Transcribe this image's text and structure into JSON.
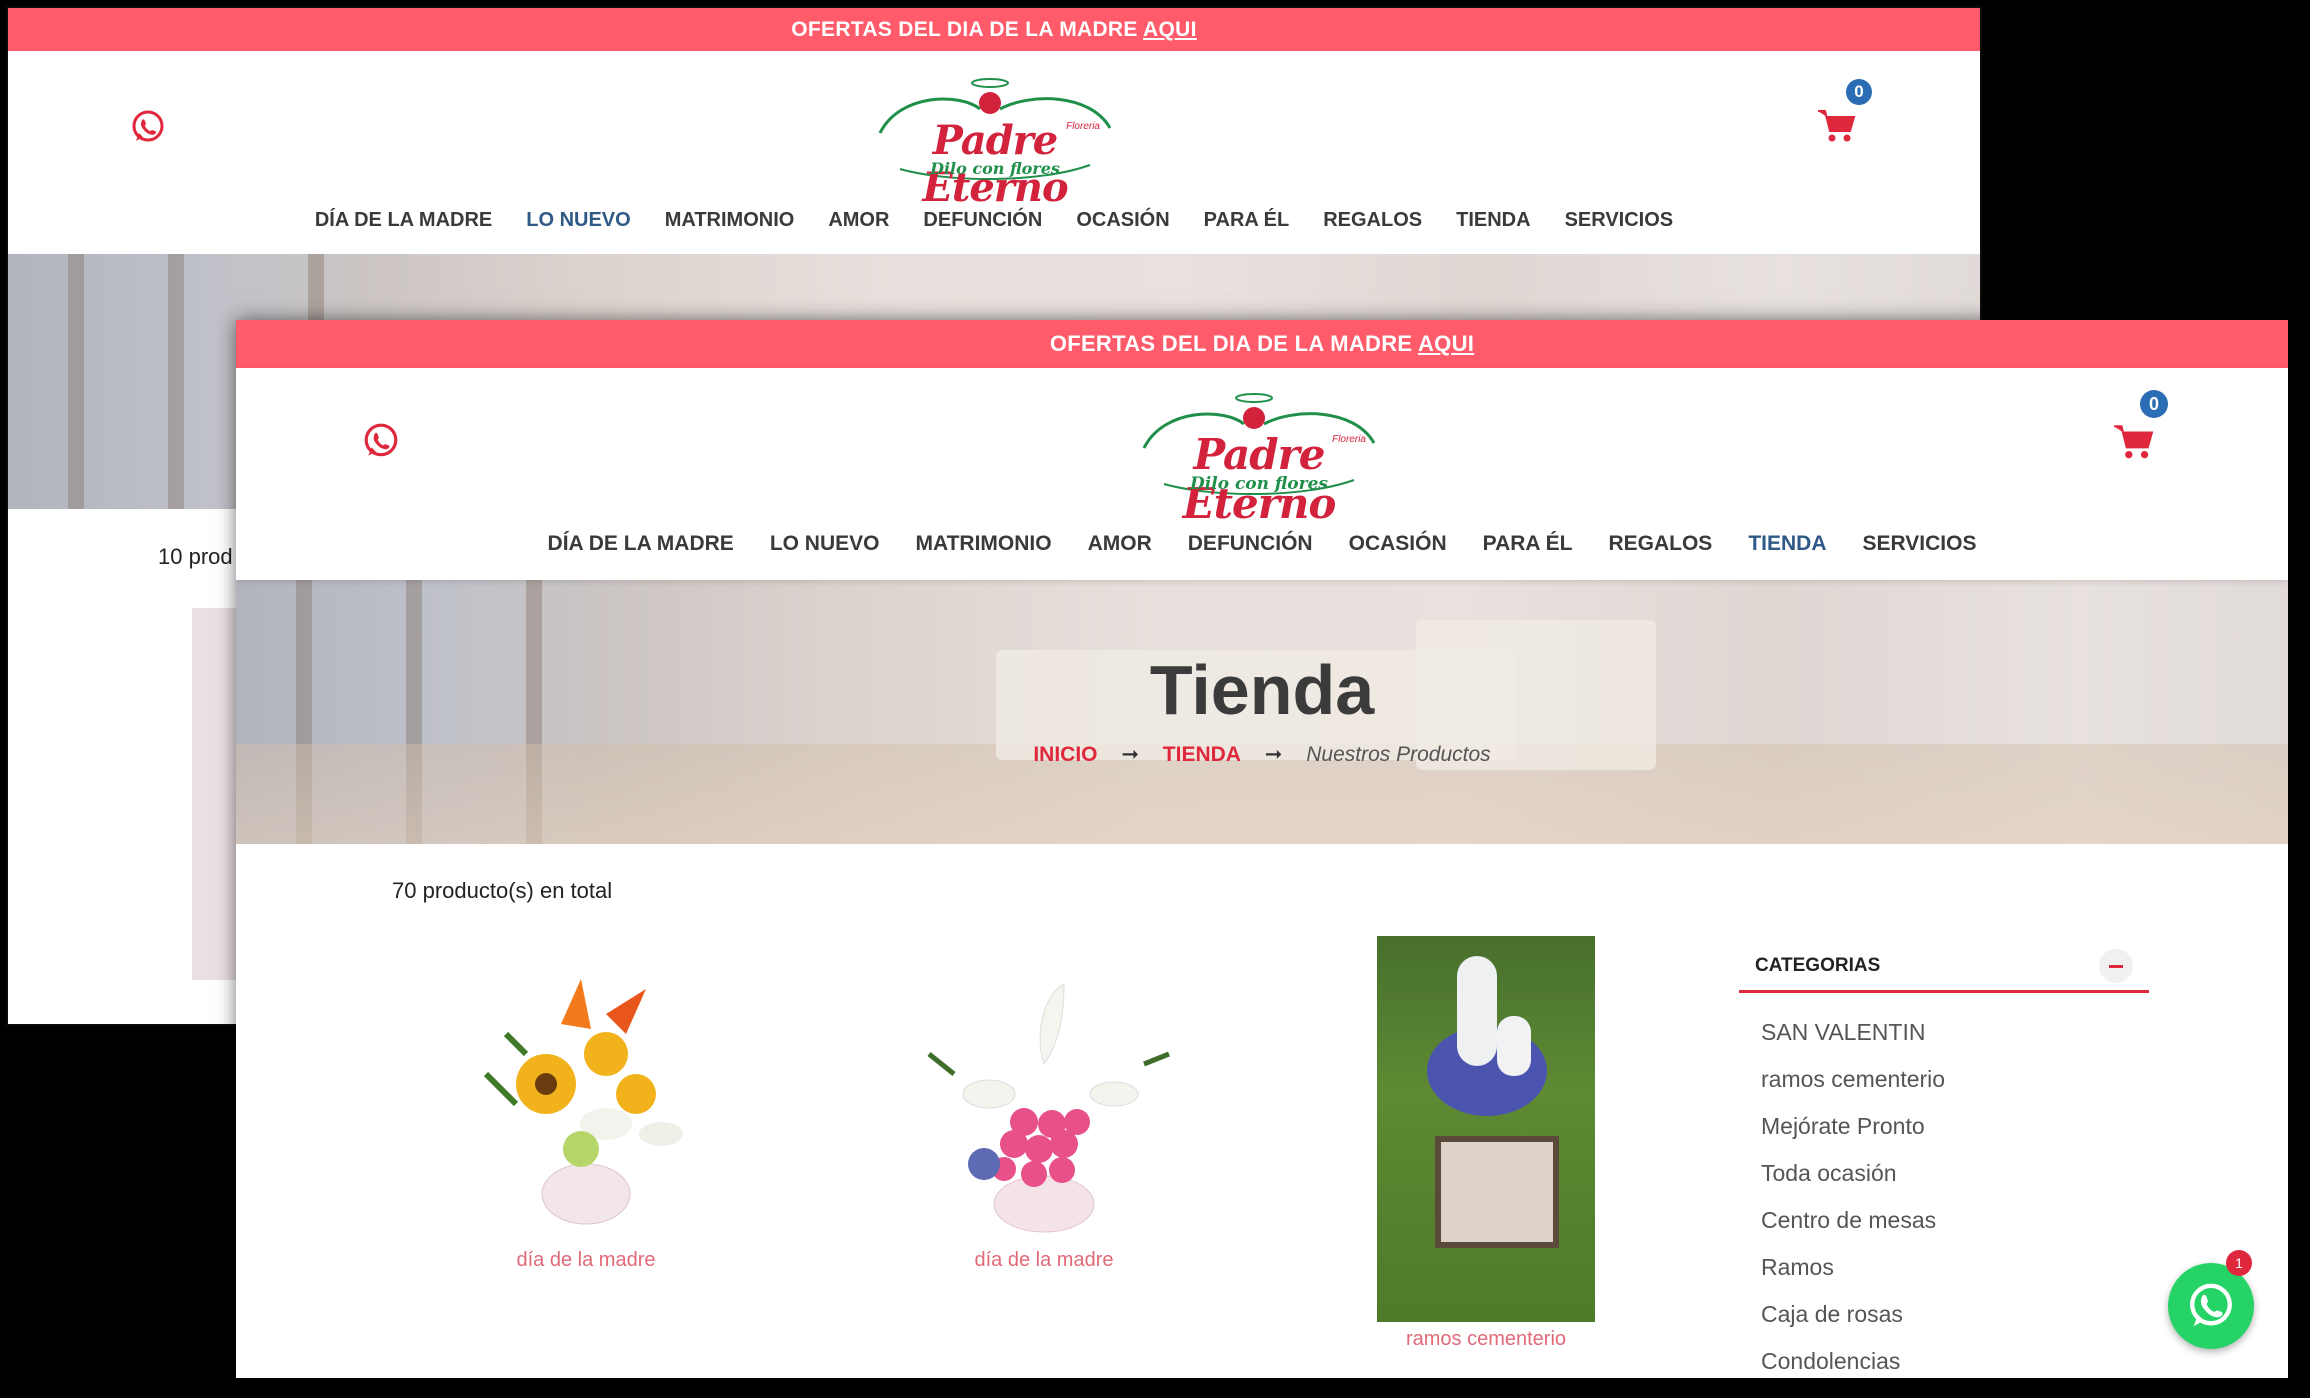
{
  "promo": {
    "text": "OFERTAS DEL DIA DE LA MADRE ",
    "link": "AQUI"
  },
  "brand": {
    "name": "Padre Eterno",
    "small": "Floreria",
    "tagline": "Dilo con flores"
  },
  "cart": {
    "count": "0"
  },
  "nav": [
    "DÍA DE LA MADRE",
    "LO NUEVO",
    "MATRIMONIO",
    "AMOR",
    "DEFUNCIÓN",
    "OCASIÓN",
    "PARA ÉL",
    "REGALOS",
    "TIENDA",
    "SERVICIOS"
  ],
  "back_window": {
    "active_nav": "LO NUEVO",
    "count_text": "10 prod"
  },
  "front_window": {
    "active_nav": "TIENDA",
    "hero_title": "Tienda",
    "breadcrumb": {
      "home": "INICIO",
      "section": "TIENDA",
      "current": "Nuestros Productos",
      "sep": "➞"
    },
    "count_text": "70 producto(s) en total",
    "products": [
      {
        "category": "día de la madre"
      },
      {
        "category": "día de la madre"
      },
      {
        "category": "ramos cementerio"
      }
    ],
    "sidebar": {
      "title": "CATEGORIAS",
      "items": [
        "SAN VALENTIN",
        "ramos cementerio",
        "Mejórate Pronto",
        "Toda ocasión",
        "Centro de mesas",
        "Ramos",
        "Caja de rosas",
        "Condolencias"
      ]
    }
  },
  "chat": {
    "badge": "1"
  },
  "colors": {
    "accent": "#ff5b6a",
    "brand_red": "#e0283c",
    "active_nav": "#2f5a88",
    "badge_blue": "#2a6db5",
    "whatsapp": "#25d366"
  }
}
